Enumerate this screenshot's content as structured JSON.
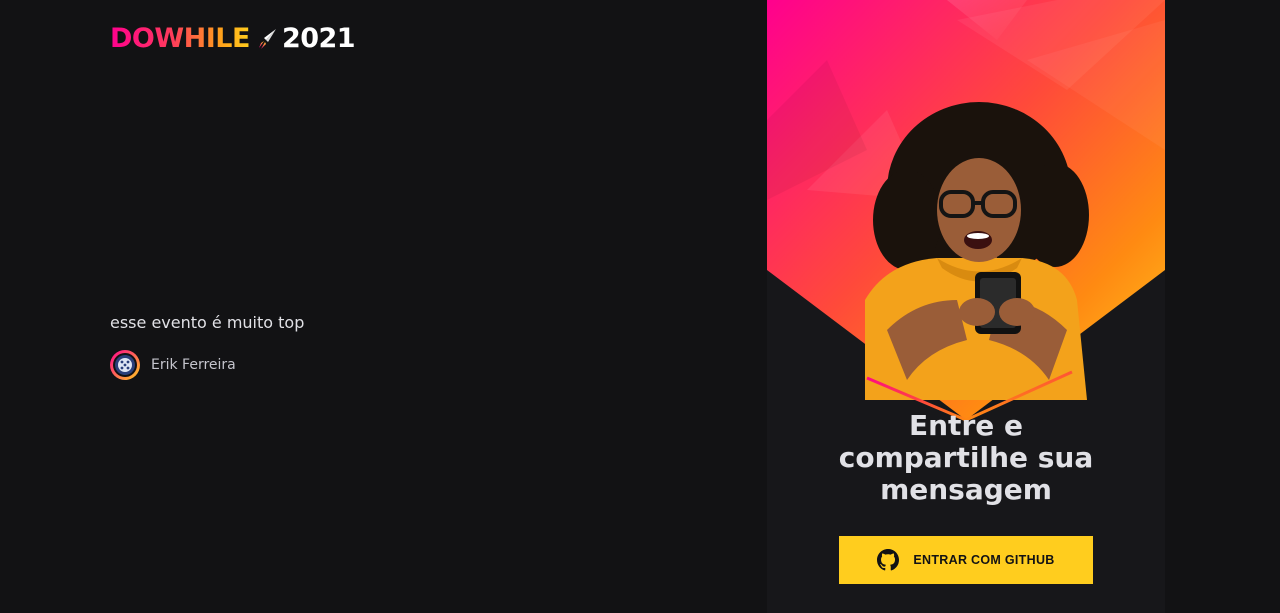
{
  "brand": {
    "logo_text": "DOWHILE",
    "logo_year": "2021",
    "gradient_colors": [
      "#ff008e",
      "#ffcd1e"
    ]
  },
  "messages": [
    {
      "text": "esse evento é muito top",
      "author": "Erik Ferreira"
    }
  ],
  "login": {
    "title_lines": [
      "Entre e",
      "compartilhe sua",
      "mensagem"
    ],
    "button_label": "ENTRAR COM GITHUB",
    "button_icon": "github-icon",
    "button_color": "#ffcd1e"
  },
  "colors": {
    "background": "#121214",
    "panel": "#17171a",
    "text": "#e1e1e6"
  }
}
